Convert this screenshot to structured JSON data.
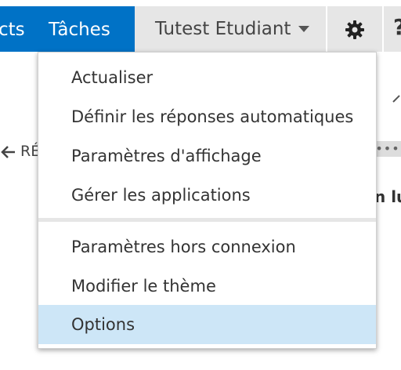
{
  "nav": {
    "contacts_label": "cts",
    "tasks_label": "Tâches"
  },
  "user": {
    "name": "Tutest Etudiant"
  },
  "background": {
    "reply_label": "RÉ",
    "more_dots": "•••",
    "day_label": "n lu"
  },
  "menu": {
    "group1": [
      {
        "label": "Actualiser"
      },
      {
        "label": "Définir les réponses automatiques"
      },
      {
        "label": "Paramètres d'affichage"
      },
      {
        "label": "Gérer les applications"
      }
    ],
    "group2": [
      {
        "label": "Paramètres hors connexion"
      },
      {
        "label": "Modifier le thème"
      },
      {
        "label": "Options",
        "selected": true
      }
    ]
  },
  "colors": {
    "brand_blue": "#0072c6",
    "selected_item": "#cde6f7",
    "header_gray": "#e6e6e6"
  },
  "icons": [
    "gear-icon",
    "chevron-down-icon",
    "help-icon",
    "reply-arrow-icon",
    "chevron-up-icon"
  ]
}
